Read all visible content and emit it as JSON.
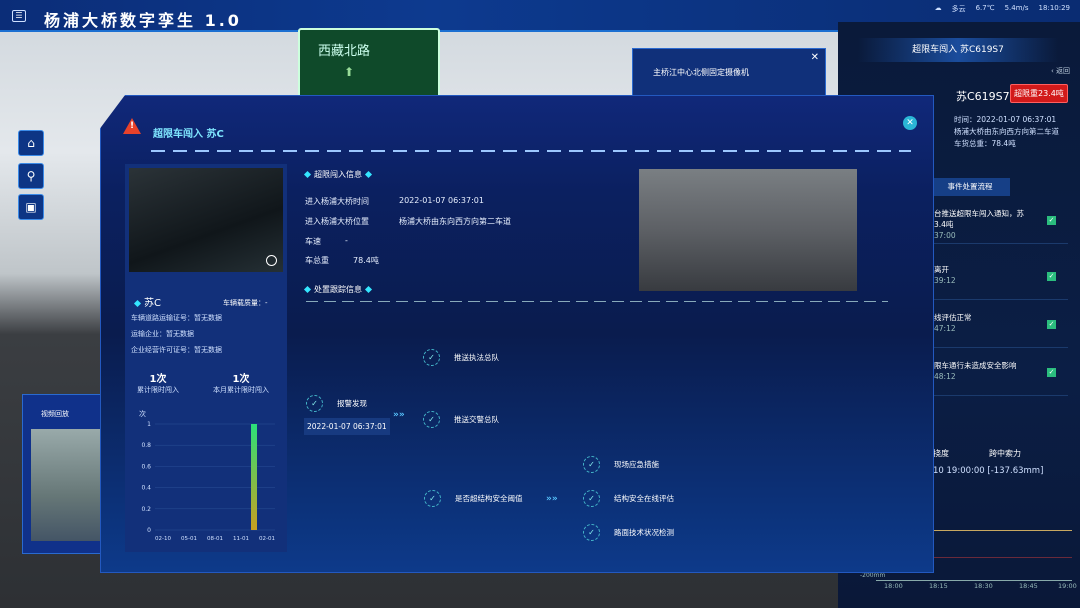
{
  "header": {
    "title": "杨浦大桥数字孪生 1.0",
    "weather": "多云",
    "temperature": "6.7℃",
    "wind": "5.4m/s",
    "time": "18:10:29"
  },
  "scene": {
    "road_sign": "西藏北路"
  },
  "camera_popup": {
    "title": "主桥江中心北侧固定摄像机"
  },
  "video_replay": {
    "title": "视频回放"
  },
  "right_panel": {
    "title": "超限车闯入 苏C619S7",
    "back": "返回",
    "plate": "苏C619S7",
    "overweight_badge": "超限重23.4吨",
    "time": "时间：2022-01-07 06:37:01",
    "location": "杨浦大桥由东向西方向第二车道",
    "total_weight": "车货总重：78.4吨",
    "process_tab": "事件处置流程",
    "steps": [
      {
        "text": "台推送超限车闯入通知，苏",
        "text2": "3.4吨",
        "time": "37:00"
      },
      {
        "text": "离开",
        "time": "39:12"
      },
      {
        "text": "线评估正常",
        "time": "47:12"
      },
      {
        "text": "限车通行未造成安全影响",
        "time": "48:12"
      }
    ],
    "tabs": [
      "挠度",
      "跨中索力"
    ],
    "deflection": "10 19:00:00 [-137.63mm]",
    "axis_min": "-200mm",
    "times": [
      "18:00",
      "18:15",
      "18:30",
      "18:45",
      "19:00"
    ]
  },
  "modal": {
    "title": "超限车闯入 苏C",
    "vehicle": {
      "plate": "苏C",
      "load_label": "车辆载质量：-",
      "permit": "车辆道路运输证号：暂无数据",
      "company": "运输企业：暂无数据",
      "license": "企业经营许可证号：暂无数据"
    },
    "stats": [
      {
        "value": "1次",
        "label": "累计限时闯入"
      },
      {
        "value": "1次",
        "label": "本月累计限时闯入"
      }
    ],
    "section1": "超限闯入信息",
    "info": [
      {
        "k": "进入杨浦大桥时间",
        "v": "2022-01-07 06:37:01"
      },
      {
        "k": "进入杨浦大桥位置",
        "v": "杨浦大桥由东向西方向第二车道"
      },
      {
        "k": "车速",
        "v": "-"
      },
      {
        "k": "车总重",
        "v": "78.4吨"
      }
    ],
    "section2": "处置跟踪信息",
    "flow": {
      "start": "报警发现",
      "start_time": "2022-01-07 06:37:01",
      "a1": "推送执法总队",
      "a2": "推送交警总队",
      "b": "是否超结构安全阈值",
      "c1": "现场应急措施",
      "c2": "结构安全在线评估",
      "c3": "路面技术状况检测"
    }
  },
  "chart_data": {
    "type": "bar",
    "ylabel": "次",
    "categories": [
      "02-10",
      "05-01",
      "08-01",
      "11-01",
      "02-01"
    ],
    "yticks": [
      "0",
      "0.2",
      "0.4",
      "0.6",
      "0.8",
      "1"
    ],
    "ylim": [
      0,
      1
    ],
    "bars": [
      {
        "x": "01-07",
        "value": 1
      }
    ],
    "bar_color": "#2be07a"
  }
}
